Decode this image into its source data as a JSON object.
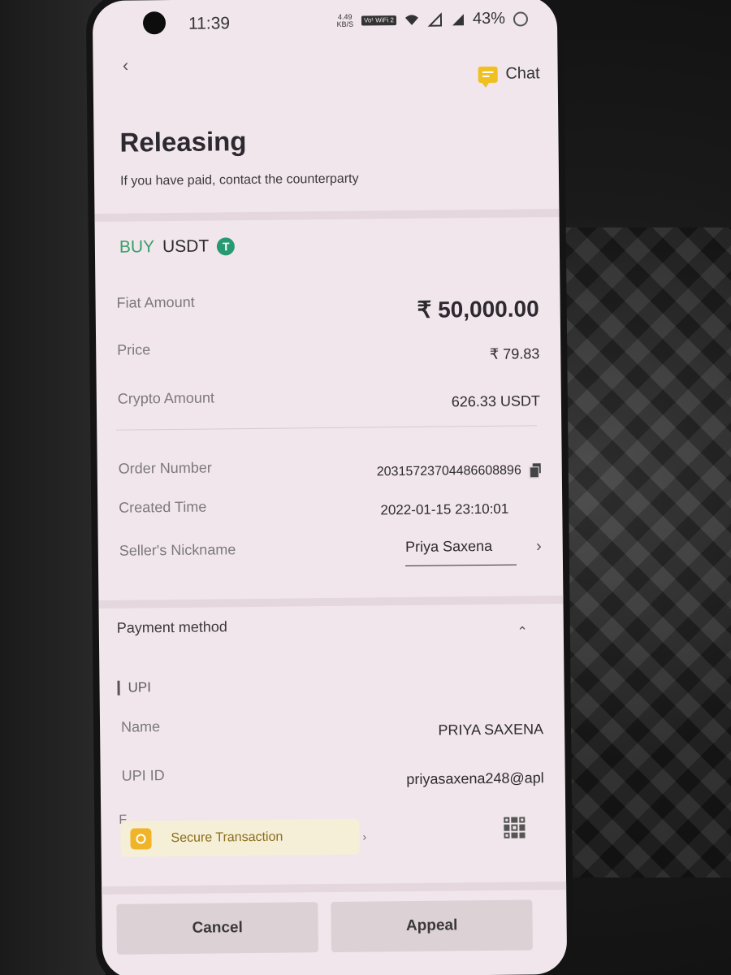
{
  "status_bar": {
    "time": "11:39",
    "net_speed_value": "4.49",
    "net_speed_unit": "KB/S",
    "wifi_badge": "Vo¹ WiFi 2",
    "battery": "43%"
  },
  "header": {
    "chat_label": "Chat",
    "title": "Releasing",
    "subtitle": "If you have paid, contact the counterparty"
  },
  "trade": {
    "side": "BUY",
    "asset": "USDT",
    "asset_icon_glyph": "T"
  },
  "amounts": {
    "fiat_amount_label": "Fiat Amount",
    "fiat_amount_value": "₹ 50,000.00",
    "price_label": "Price",
    "price_value": "₹ 79.83",
    "crypto_amount_label": "Crypto Amount",
    "crypto_amount_value": "626.33 USDT"
  },
  "order": {
    "order_number_label": "Order Number",
    "order_number_value": "20315723704486608896",
    "created_time_label": "Created Time",
    "created_time_value": "2022-01-15 23:10:01",
    "seller_label": "Seller's Nickname",
    "seller_value": "Priya Saxena"
  },
  "payment": {
    "section_title": "Payment method",
    "method": "UPI",
    "name_label": "Name",
    "name_value": "PRIYA SAXENA",
    "upi_id_label": "UPI ID",
    "upi_id_value": "priyasaxena248@apl",
    "clipped_label": "F",
    "secure_label": "Secure Transaction"
  },
  "actions": {
    "cancel_label": "Cancel",
    "appeal_label": "Appeal"
  },
  "colors": {
    "buy_green": "#34a06a",
    "tether_green": "#279a72",
    "chat_yellow": "#f0c020",
    "secure_orange": "#f0b429"
  }
}
